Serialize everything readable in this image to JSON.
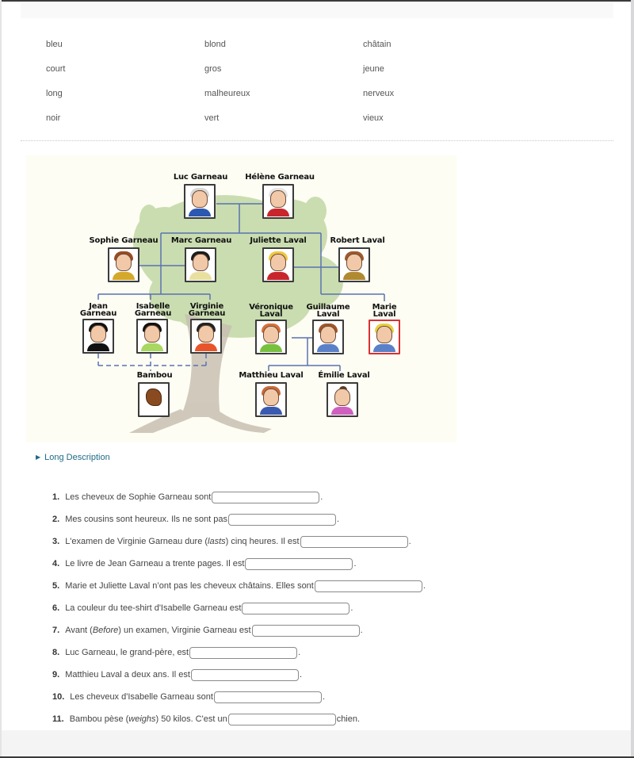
{
  "word_bank": [
    [
      "bleu",
      "blond",
      "châtain"
    ],
    [
      "court",
      "gros",
      "jeune"
    ],
    [
      "long",
      "malheureux",
      "nerveux"
    ],
    [
      "noir",
      "vert",
      "vieux"
    ]
  ],
  "family_tree": {
    "people": [
      {
        "id": "luc",
        "name": "Luc Garneau",
        "hair": "#d8d8d8",
        "shirt": "#2b58b0"
      },
      {
        "id": "helene",
        "name": "Hélène Garneau",
        "hair": "#e6e6e6",
        "shirt": "#c8262c"
      },
      {
        "id": "sophie",
        "name": "Sophie Garneau",
        "hair": "#9a4a22",
        "shirt": "#d4a82a"
      },
      {
        "id": "marc",
        "name": "Marc Garneau",
        "hair": "#1b1b1b",
        "shirt": "#e8e0a0"
      },
      {
        "id": "juliette",
        "name": "Juliette Laval",
        "hair": "#f0c840",
        "shirt": "#c8262c"
      },
      {
        "id": "robert",
        "name": "Robert Laval",
        "hair": "#a05a2a",
        "shirt": "#b08a30"
      },
      {
        "id": "jean",
        "name_line1": "Jean",
        "name_line2": "Garneau",
        "hair": "#111111",
        "shirt": "#111111"
      },
      {
        "id": "isabelle",
        "name_line1": "Isabelle",
        "name_line2": "Garneau",
        "hair": "#111111",
        "shirt": "#a8d860"
      },
      {
        "id": "virginie",
        "name_line1": "Virginie",
        "name_line2": "Garneau",
        "hair": "#222222",
        "shirt": "#e8552a"
      },
      {
        "id": "veronique",
        "name_line1": "Véronique",
        "name_line2": "Laval",
        "hair": "#d8703a",
        "shirt": "#78c040"
      },
      {
        "id": "guillaume",
        "name_line1": "Guillaume",
        "name_line2": "Laval",
        "hair": "#a0552a",
        "shirt": "#5a80c8"
      },
      {
        "id": "marie",
        "name_line1": "Marie",
        "name_line2": "Laval",
        "hair": "#e8d040",
        "shirt": "#5a80c8"
      },
      {
        "id": "bambou",
        "name": "Bambou",
        "hair": "#8a4a20",
        "shirt": "#8a4a20"
      },
      {
        "id": "matthieu",
        "name": "Matthieu Laval",
        "hair": "#c86a3a",
        "shirt": "#3a5ab0"
      },
      {
        "id": "emilie",
        "name": "Émilie Laval",
        "hair": "#5a3a2a",
        "shirt": "#d060c0"
      }
    ],
    "highlighted": "marie"
  },
  "long_description_label": "Long Description",
  "questions": [
    {
      "num": "1.",
      "before": "Les cheveux de Sophie Garneau sont",
      "after": ".",
      "value": ""
    },
    {
      "num": "2.",
      "before": "Mes cousins sont heureux. Ils ne sont pas",
      "after": ".",
      "value": ""
    },
    {
      "num": "3.",
      "before": "L'examen de Virginie Garneau dure (",
      "italic": "lasts",
      "before2": ") cinq heures. Il est",
      "after": ".",
      "value": ""
    },
    {
      "num": "4.",
      "before": "Le livre de Jean Garneau a trente pages. Il est",
      "after": ".",
      "value": ""
    },
    {
      "num": "5.",
      "before": "Marie et Juliette Laval n’ont pas les cheveux châtains. Elles sont",
      "after": ".",
      "value": ""
    },
    {
      "num": "6.",
      "before": "La couleur du tee-shirt d'Isabelle Garneau est",
      "after": ".",
      "value": ""
    },
    {
      "num": "7.",
      "before": "Avant (",
      "italic": "Before",
      "before2": ") un examen, Virginie Garneau est",
      "after": ".",
      "value": ""
    },
    {
      "num": "8.",
      "before": "Luc Garneau, le grand-père, est",
      "after": ".",
      "value": ""
    },
    {
      "num": "9.",
      "before": "Matthieu Laval a deux ans. Il est",
      "after": ".",
      "value": ""
    },
    {
      "num": "10.",
      "before": "Les cheveux d'Isabelle Garneau sont",
      "after": ".",
      "value": ""
    },
    {
      "num": "11.",
      "before": "Bambou pèse (",
      "italic": "weighs",
      "before2": ") 50 kilos. C'est un",
      "after": "chien.",
      "value": ""
    }
  ],
  "colors": {
    "link": "#1e6a8a",
    "highlight_border": "#d9312f",
    "tree_line": "#5a72b0",
    "tree_bg": "#fdfdf3"
  }
}
